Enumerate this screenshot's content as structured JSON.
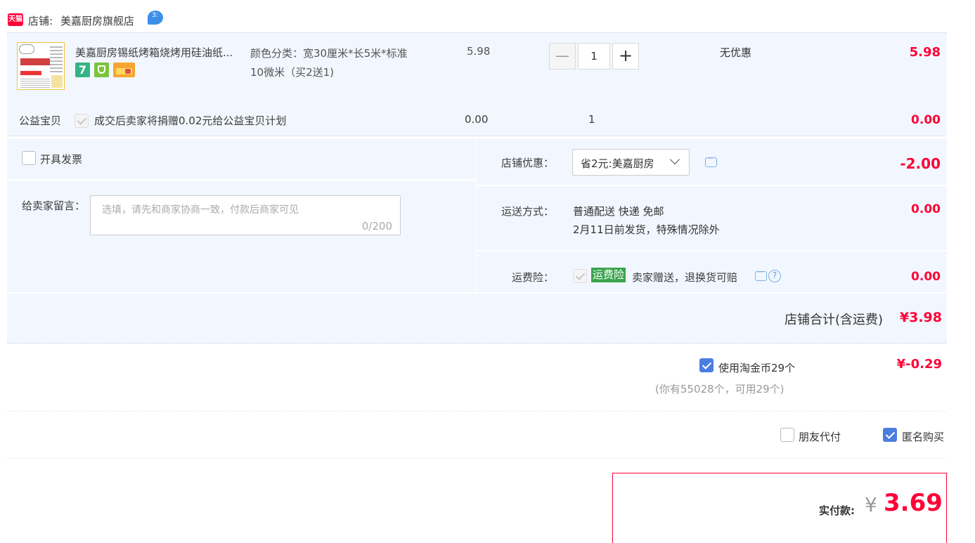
{
  "shop": {
    "tmall_badge": "天猫",
    "label": "店铺:",
    "name": "美嘉厨房旗舰店"
  },
  "item": {
    "title": "美嘉厨房锡纸烤箱烧烤用硅油纸...",
    "spec": "颜色分类：宽30厘米*长5米*标准10微米（买2送1)",
    "price": "5.98",
    "quantity": "1",
    "minus": "—",
    "plus": "+",
    "discount": "无优惠",
    "subtotal": "5.98",
    "badge_7": "7"
  },
  "charity": {
    "label": "公益宝贝",
    "text": "成交后卖家将捐赠0.02元给公益宝贝计划",
    "price": "0.00",
    "quantity": "1",
    "subtotal": "0.00"
  },
  "invoice": {
    "label": "开具发票"
  },
  "message": {
    "label": "给卖家留言：",
    "placeholder": "选填，请先和商家协商一致，付款后商家可见",
    "counter": "0/200"
  },
  "shop_discount": {
    "label": "店铺优惠：",
    "selected": "省2元:美嘉厨房",
    "amount": "-2.00"
  },
  "shipping": {
    "label": "运送方式：",
    "method": "普通配送 快递 免邮",
    "note": "2月11日前发货，特殊情况除外",
    "amount": "0.00"
  },
  "insurance": {
    "label": "运费险：",
    "tag": "运费险",
    "text": "卖家赠送，退换货可赔",
    "amount": "0.00"
  },
  "shop_total": {
    "label": "店铺合计(含运费)",
    "amount": "¥3.98"
  },
  "coins": {
    "label": "使用淘金币29个",
    "note": "(你有55028个，可用29个)",
    "amount": "¥-0.29"
  },
  "options": {
    "friend_pay": "朋友代付",
    "anonymous": "匿名购买"
  },
  "payment": {
    "label": "实付款:",
    "currency": "¥",
    "amount": "3.69"
  },
  "colors": {
    "accent": "#ff0036",
    "checkbox": "#4a7de0",
    "panel": "#f2f7ff",
    "insurance_tag": "#3aa44d"
  }
}
